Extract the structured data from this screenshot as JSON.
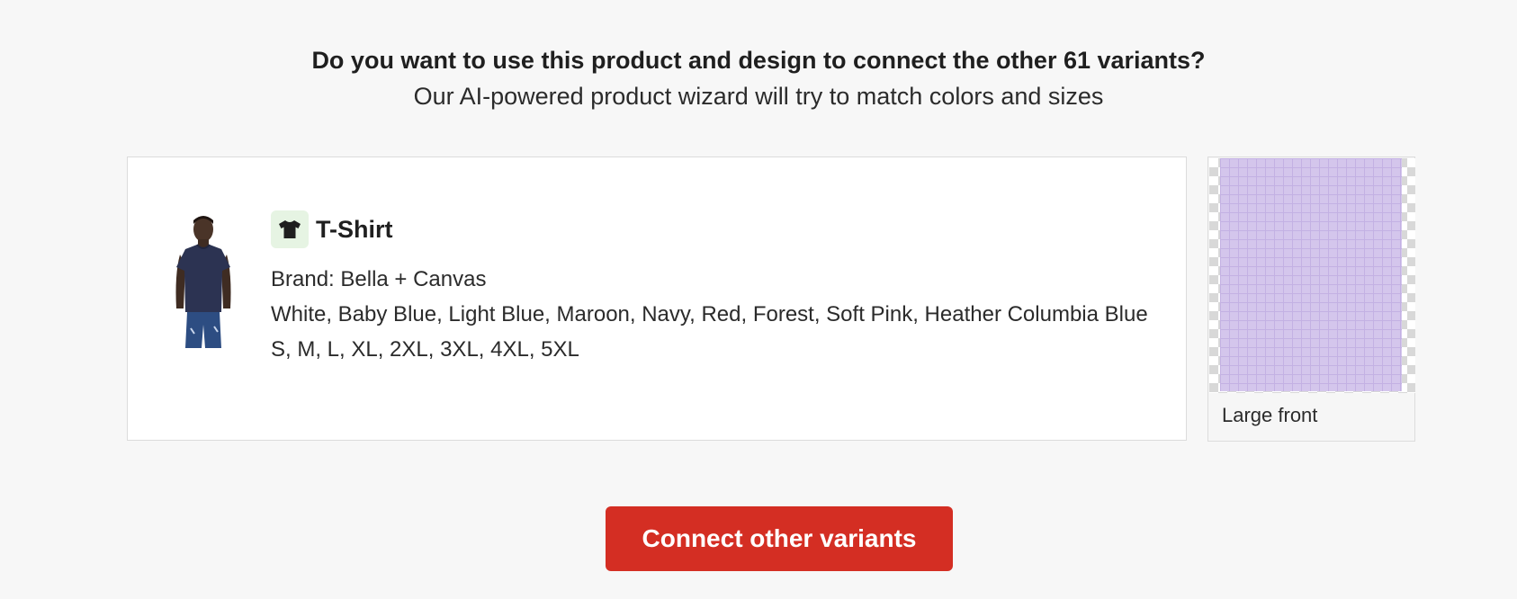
{
  "header": {
    "title": "Do you want to use this product and design to connect the other 61 variants?",
    "subtitle": "Our AI-powered product wizard will try to match colors and sizes"
  },
  "product": {
    "image_icon": "model-wearing-navy-tshirt-image",
    "type_icon": "tshirt-icon",
    "title": "T-Shirt",
    "brand": "Brand: Bella + Canvas",
    "colors": "White, Baby Blue, Light Blue, Maroon, Navy, Red, Forest, Soft Pink, Heather Columbia Blue",
    "sizes": "S, M, L, XL, 2XL, 3XL, 4XL, 5XL"
  },
  "design": {
    "preview_fill_color": "#d4c6ec",
    "label": "Large front"
  },
  "actions": {
    "connect_label": "Connect other variants"
  },
  "colors": {
    "background": "#f7f7f7",
    "accent": "#d42e23",
    "icon_badge": "#e6f4e3"
  }
}
